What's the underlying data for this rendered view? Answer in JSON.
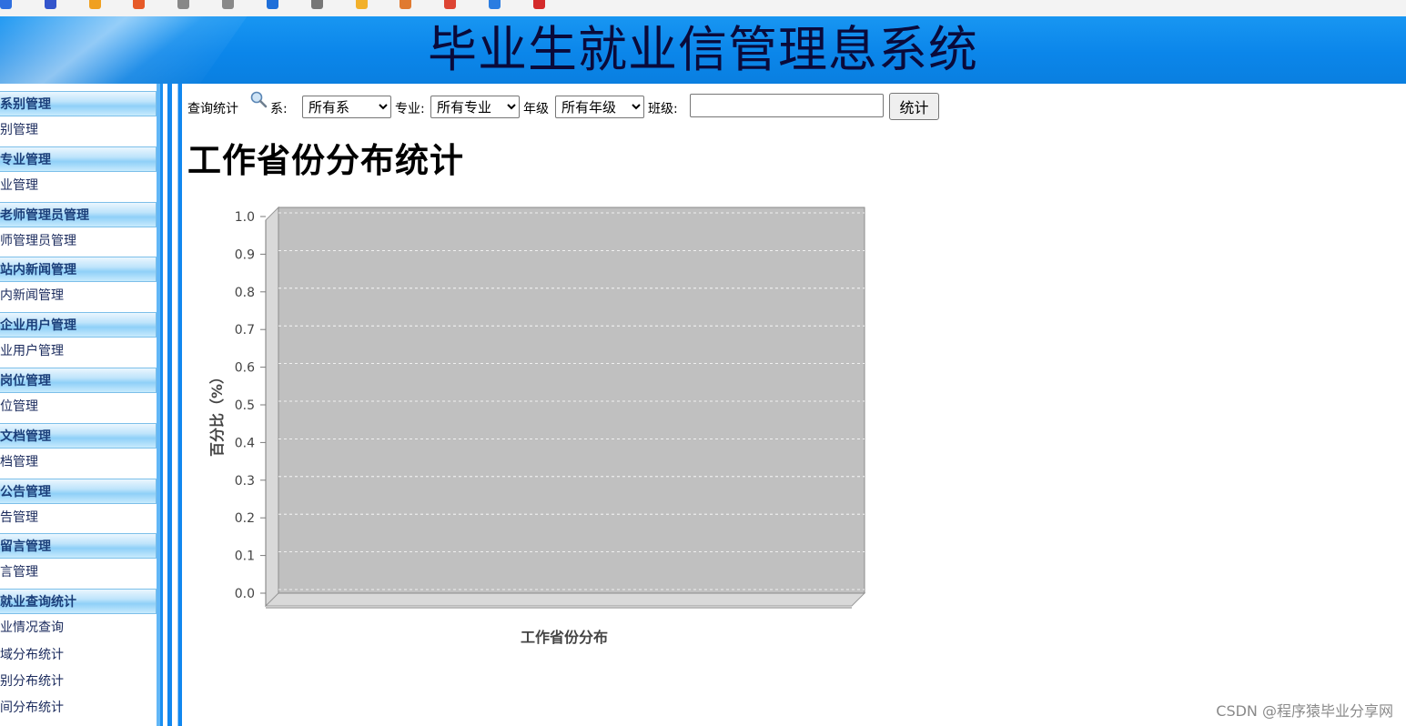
{
  "header": {
    "title": "毕业生就业信管理息系统"
  },
  "sidebar": {
    "groups": [
      {
        "label": "系别管理",
        "item": "别管理"
      },
      {
        "label": "专业管理",
        "item": "业管理"
      },
      {
        "label": "老师管理员管理",
        "item": "师管理员管理"
      },
      {
        "label": "站内新闻管理",
        "item": "内新闻管理"
      },
      {
        "label": "企业用户管理",
        "item": "业用户管理"
      },
      {
        "label": "岗位管理",
        "item": "位管理"
      },
      {
        "label": "文档管理",
        "item": "档管理"
      },
      {
        "label": "公告管理",
        "item": "告管理"
      },
      {
        "label": "留言管理",
        "item": "言管理"
      },
      {
        "label": "就业查询统计",
        "item": "业情况查询"
      }
    ],
    "extra_items": [
      "域分布统计",
      "别分布统计",
      "间分布统计"
    ]
  },
  "search": {
    "label": "查询统计",
    "dept_label": "系:",
    "dept_value": "所有系",
    "major_label": "专业:",
    "major_value": "所有专业",
    "grade_label": "年级",
    "grade_value": "所有年级",
    "class_label": "班级:",
    "class_value": "",
    "submit": "统计"
  },
  "page_title": "工作省份分布统计",
  "chart_data": {
    "type": "bar",
    "categories": [],
    "series": [],
    "xlabel": "工作省份分布",
    "ylabel": "百分比（%）",
    "ylim": [
      0,
      1.0
    ],
    "yticks": [
      "0.0",
      "0.1",
      "0.2",
      "0.3",
      "0.4",
      "0.5",
      "0.6",
      "0.7",
      "0.8",
      "0.9",
      "1.0"
    ],
    "grid": true,
    "plot_background": "#c0c0c0",
    "render_3d": true
  },
  "watermark": "CSDN @程序猿毕业分享网",
  "colors": {
    "header_blue": "#0b86ea",
    "sidebar_group_text": "#1b3f7a",
    "plot_gray": "#c0c0c0"
  }
}
